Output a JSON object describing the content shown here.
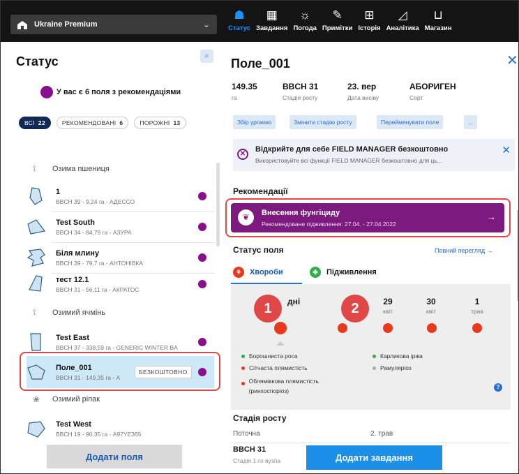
{
  "topbar": {
    "farm_name": "Ukraine Premium",
    "nav": [
      {
        "label": "Статус",
        "icon": "status-icon",
        "glyph": "☗",
        "active": true
      },
      {
        "label": "Завдання",
        "icon": "calendar-icon",
        "glyph": "▦",
        "active": false
      },
      {
        "label": "Погода",
        "icon": "weather-icon",
        "glyph": "☼",
        "active": false
      },
      {
        "label": "Примітки",
        "icon": "notes-icon",
        "glyph": "✎",
        "active": false
      },
      {
        "label": "Історія",
        "icon": "history-icon",
        "glyph": "⊞",
        "active": false
      },
      {
        "label": "Аналітика",
        "icon": "analytics-icon",
        "glyph": "◿",
        "active": false
      },
      {
        "label": "Магазин",
        "icon": "cart-icon",
        "glyph": "⊔",
        "active": false
      }
    ]
  },
  "left": {
    "title": "Статус",
    "recommend_text": "У вас є 6 поля з рекомендаціями",
    "chips": [
      {
        "label": "ВСІ",
        "count": "22"
      },
      {
        "label": "РЕКОМЕНДОВАНІ",
        "count": "6"
      },
      {
        "label": "ПОРОЖНІ",
        "count": "13"
      }
    ],
    "crops": [
      "Озима пшениця",
      "Озимий ячмінь",
      "Озимий ріпак"
    ],
    "fields": [
      {
        "name": "1",
        "desc": "BBCH 39 - 9,24 га - АДЕССО",
        "dot": true
      },
      {
        "name": "Test South",
        "desc": "BBCH 34 - 84,79 га - АЗУРА",
        "dot": true
      },
      {
        "name": "Біля млину",
        "desc": "BBCH 39 - 79,7 га - АНТОНІВКА",
        "dot": true
      },
      {
        "name": "тест 12.1",
        "desc": "BBCH 31 - 56,11 га - АКРАТОС",
        "dot": true
      },
      {
        "name": "Test East",
        "desc": "BBCH 37 - 338,59 га - GENERIC WINTER BA",
        "dot": true
      },
      {
        "name": "Поле_001",
        "desc": "BBCH 31 - 149,35 га - А",
        "dot": true
      },
      {
        "name": "Test West",
        "desc": "BBCH 19 - 90.35 га - A97YE365",
        "dot": false
      }
    ],
    "free_badge": "БЕЗКОШТОВНО",
    "add_button": "Додати поля"
  },
  "right": {
    "title": "Поле_001",
    "stats": [
      {
        "value": "149.35",
        "label": "га"
      },
      {
        "value": "BBCH 31",
        "label": "Стадія росту"
      },
      {
        "value": "23. вер",
        "label": "Дата висіву"
      },
      {
        "value": "АБОРИГЕН",
        "label": "Сорт"
      }
    ],
    "actions": [
      "Збір урожаю",
      "Змінити стадію росту",
      "Перейменувати поле",
      "..."
    ],
    "promo": {
      "title": "Відкрийте для себе FIELD MANAGER безкоштовно",
      "subtitle": "Використовуйте всі функції FIELD MANAGER безкоштовно для ць..."
    },
    "recommendations_title": "Рекомендації",
    "recommendation": {
      "title": "Внесення фунгіциду",
      "subtitle": "Рекомендоване підживлення: 27.04. - 27.04.2022"
    },
    "field_status_title": "Статус поля",
    "full_view_link": "Повний перегляд →",
    "tabs": [
      "Хвороби",
      "Підживлення"
    ],
    "timeline_today_partial": "дні",
    "timeline": [
      {
        "day": "29",
        "month": "квіт"
      },
      {
        "day": "30",
        "month": "квіт"
      },
      {
        "day": "1",
        "month": "трав"
      }
    ],
    "markers": [
      "1",
      "2"
    ],
    "legend": [
      {
        "label": "Борошниста роса",
        "color": "#2fb04a"
      },
      {
        "label": "Карликова іржа",
        "color": "#2fb04a"
      },
      {
        "label": "Сітчаста плямистість",
        "color": "#e8391d"
      },
      {
        "label": "Рамуляріоз",
        "color": "#aaaaaa"
      },
      {
        "label": "Облямівкова плямистість (ринхоспоріоз)",
        "color": "#e8391d"
      }
    ],
    "growth_title": "Стадія росту",
    "growth_current_label": "Поточна",
    "growth_next_date": "2. трав",
    "growth_value": "BBCH 31",
    "growth_desc": "Стадія 1-го вузла",
    "add_task_button": "Додати завдання"
  },
  "colors": {
    "accent": "#1c8fe8",
    "purple": "#7d1a80",
    "red": "#e04848",
    "selected": "#cde8f7"
  }
}
